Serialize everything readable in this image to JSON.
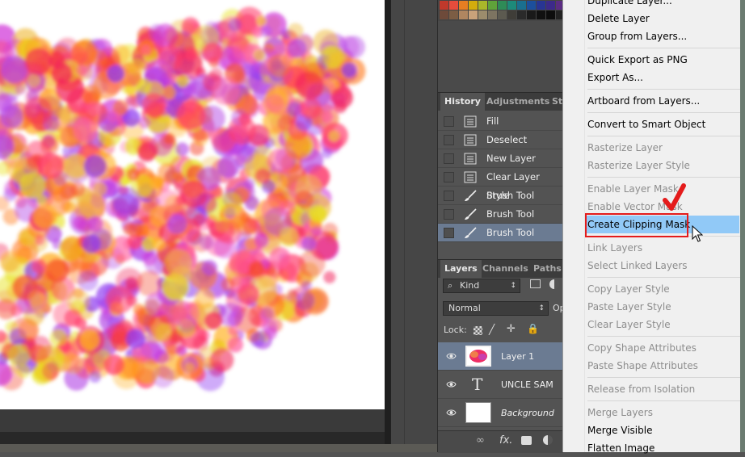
{
  "canvas": {
    "artwork": "paint-splatter"
  },
  "history": {
    "tabs": [
      "History",
      "Adjustments",
      "Sty"
    ],
    "items": [
      {
        "label": "Fill",
        "icon": "document-icon"
      },
      {
        "label": "Deselect",
        "icon": "document-icon"
      },
      {
        "label": "New Layer",
        "icon": "document-icon"
      },
      {
        "label": "Clear Layer Style",
        "icon": "document-icon"
      },
      {
        "label": "Brush Tool",
        "icon": "brush-icon"
      },
      {
        "label": "Brush Tool",
        "icon": "brush-icon"
      },
      {
        "label": "Brush Tool",
        "icon": "brush-icon",
        "selected": true
      }
    ]
  },
  "layers": {
    "tabs": [
      "Layers",
      "Channels",
      "Paths"
    ],
    "filter_label": "Kind",
    "blend_mode": "Normal",
    "opacity_label": "Op",
    "lock_label": "Lock:",
    "items": [
      {
        "name": "Layer 1",
        "selected": true,
        "thumb": "paint"
      },
      {
        "name": "UNCLE SAM",
        "thumb": "text"
      },
      {
        "name": "Background",
        "thumb": "white",
        "italic": true
      }
    ],
    "footer_fx": "fx."
  },
  "context_menu": {
    "items": [
      {
        "label": "Duplicate Layer...",
        "disabled": false
      },
      {
        "label": "Delete Layer",
        "disabled": false
      },
      {
        "label": "Group from Layers...",
        "disabled": false
      },
      {
        "sep": true
      },
      {
        "label": "Quick Export as PNG",
        "disabled": false
      },
      {
        "label": "Export As...",
        "disabled": false
      },
      {
        "sep": true
      },
      {
        "label": "Artboard from Layers...",
        "disabled": false
      },
      {
        "sep": true
      },
      {
        "label": "Convert to Smart Object",
        "disabled": false
      },
      {
        "sep": true
      },
      {
        "label": "Rasterize Layer",
        "disabled": true
      },
      {
        "label": "Rasterize Layer Style",
        "disabled": true
      },
      {
        "sep": true
      },
      {
        "label": "Enable Layer Mask",
        "disabled": true
      },
      {
        "label": "Enable Vector Mask",
        "disabled": true
      },
      {
        "label": "Create Clipping Mask",
        "disabled": false,
        "hover": true
      },
      {
        "sep": true
      },
      {
        "label": "Link Layers",
        "disabled": true
      },
      {
        "label": "Select Linked Layers",
        "disabled": true
      },
      {
        "sep": true
      },
      {
        "label": "Copy Layer Style",
        "disabled": true
      },
      {
        "label": "Paste Layer Style",
        "disabled": true
      },
      {
        "label": "Clear Layer Style",
        "disabled": true
      },
      {
        "sep": true
      },
      {
        "label": "Copy Shape Attributes",
        "disabled": true
      },
      {
        "label": "Paste Shape Attributes",
        "disabled": true
      },
      {
        "sep": true
      },
      {
        "label": "Release from Isolation",
        "disabled": true
      },
      {
        "sep": true
      },
      {
        "label": "Merge Layers",
        "disabled": true
      },
      {
        "label": "Merge Visible",
        "disabled": false
      },
      {
        "label": "Flatten Image",
        "disabled": false
      }
    ]
  },
  "annotation": {
    "highlight_color": "#e41b1b",
    "check_color": "#e41b1b"
  },
  "colors": {
    "selection": "#6b7b92",
    "menu_hover": "#91c9f7"
  }
}
